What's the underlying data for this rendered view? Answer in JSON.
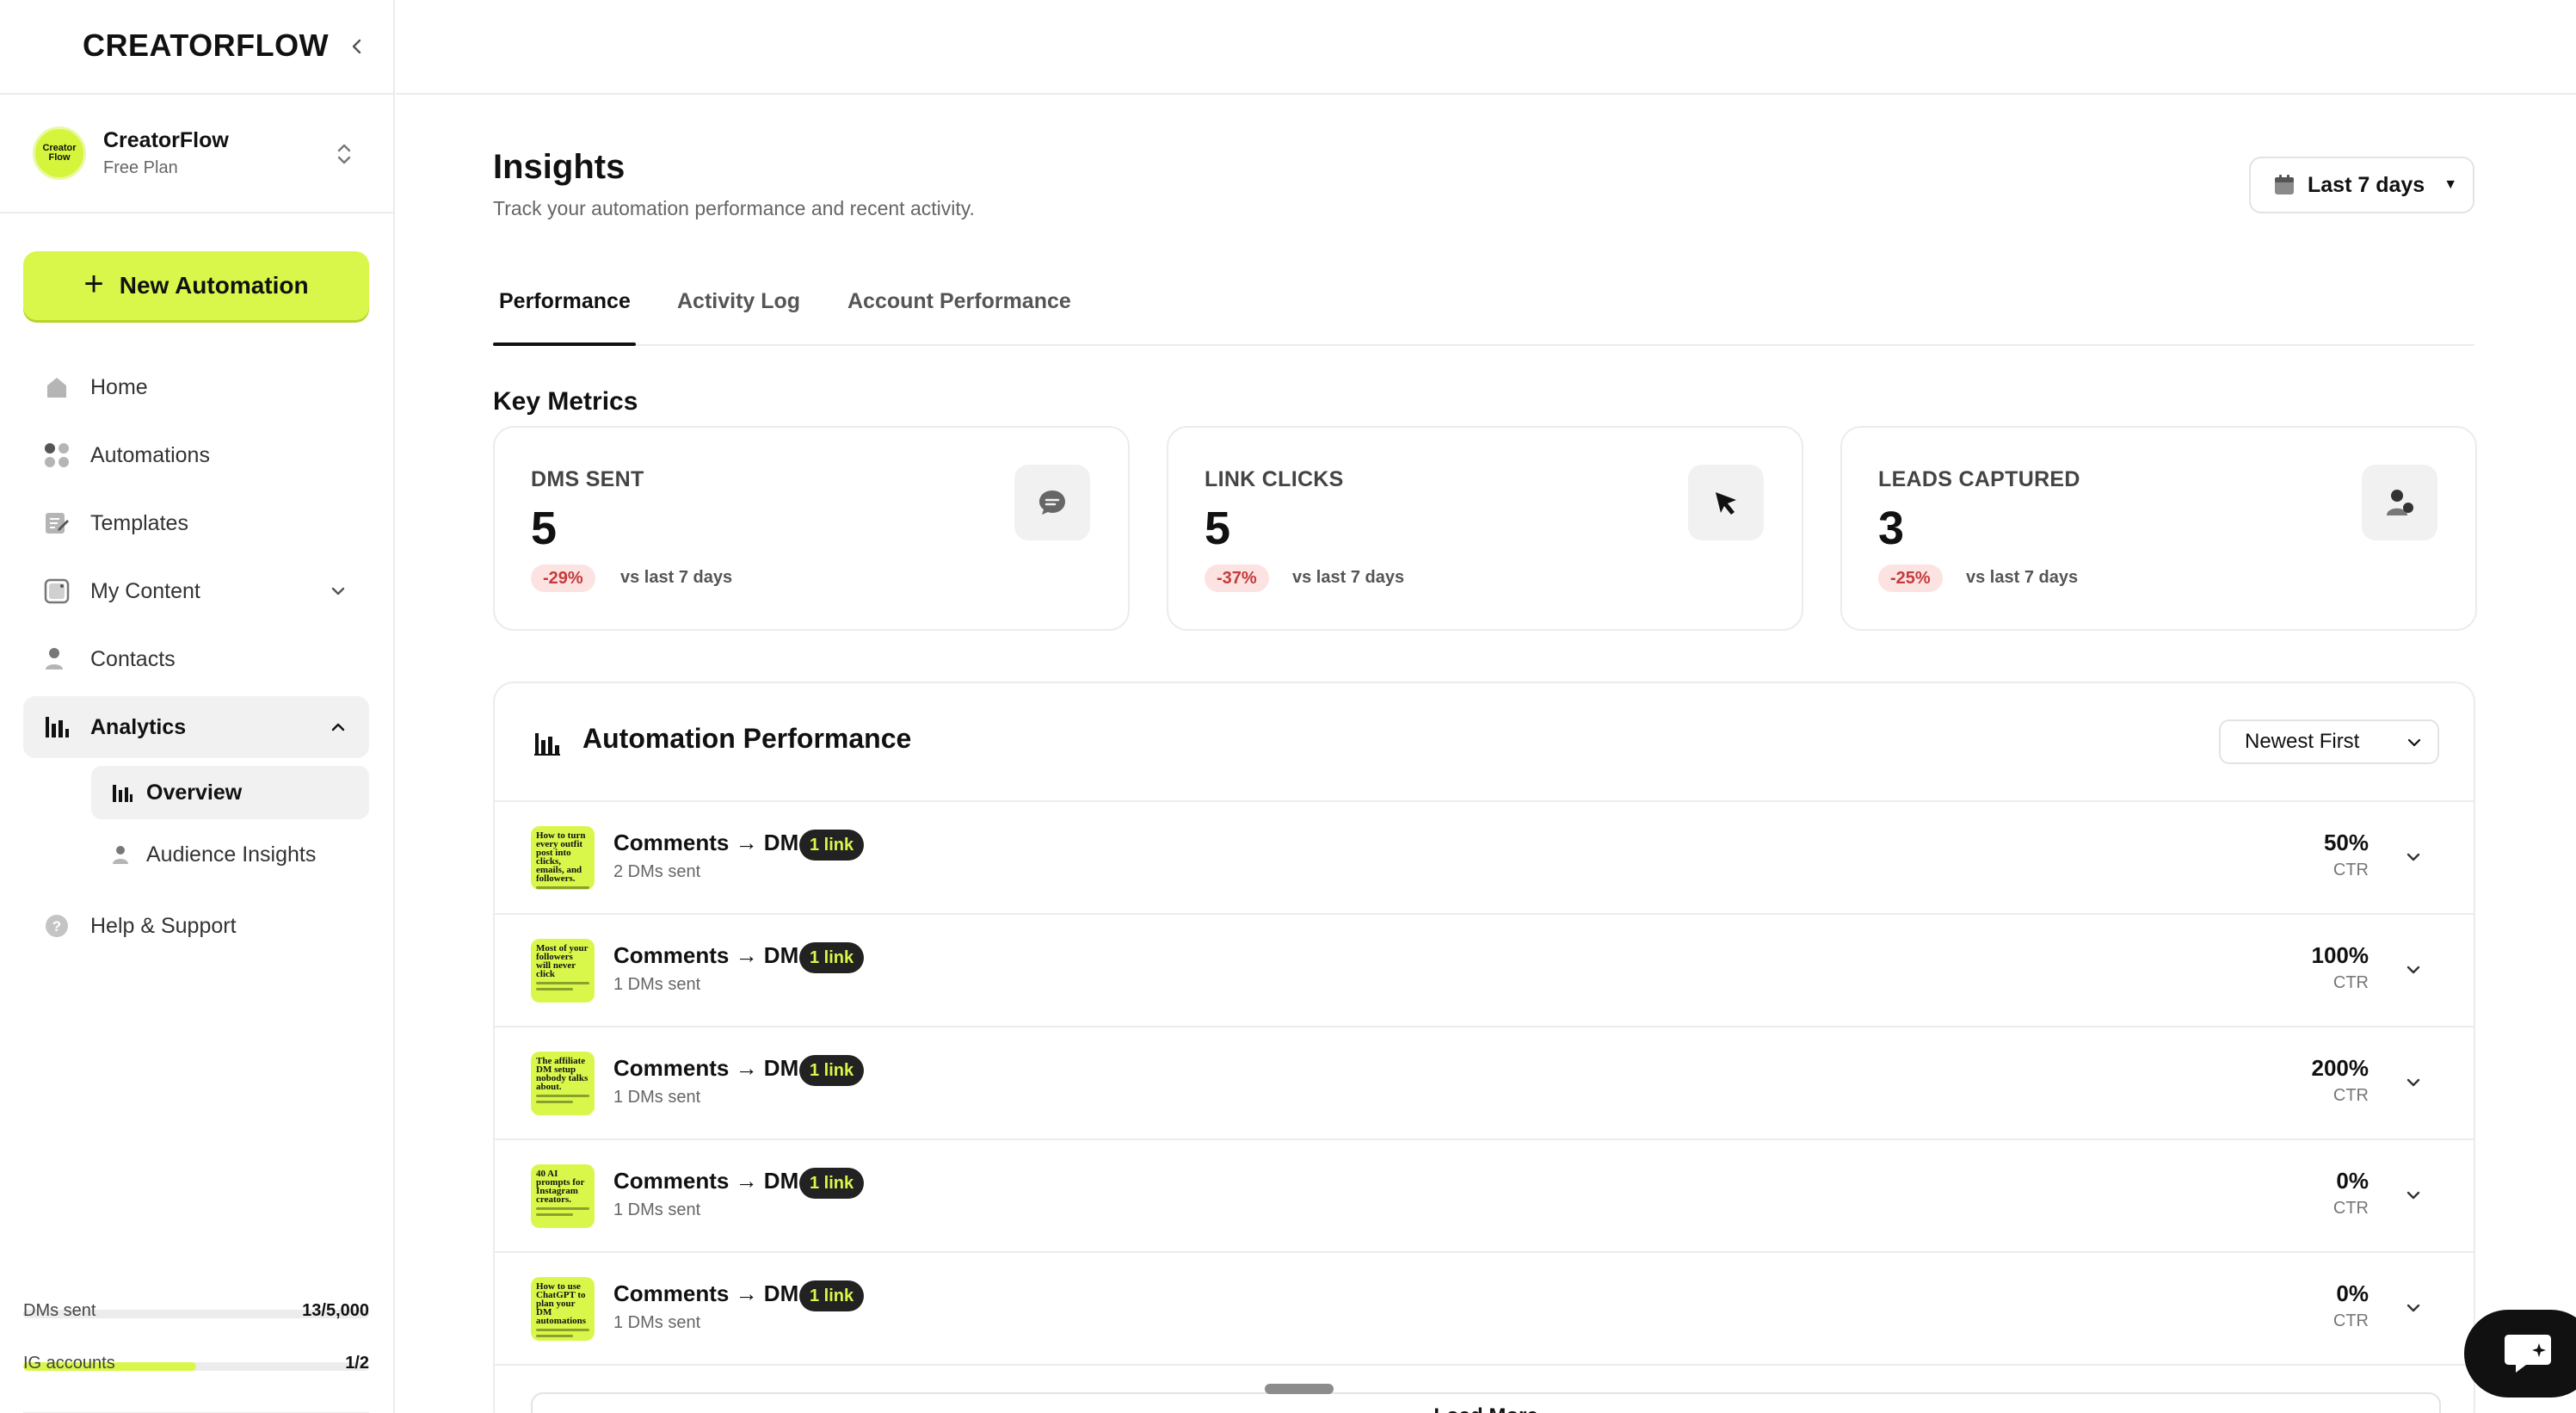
{
  "brand": {
    "name": "CREATORFLOW"
  },
  "account": {
    "name": "CreatorFlow",
    "plan": "Free Plan",
    "avatar_text": "Creator Flow"
  },
  "sidebar": {
    "new_button": "New Automation",
    "items": [
      {
        "label": "Home",
        "icon": "home-icon"
      },
      {
        "label": "Automations",
        "icon": "automations-icon"
      },
      {
        "label": "Templates",
        "icon": "templates-icon"
      },
      {
        "label": "My Content",
        "icon": "content-icon"
      },
      {
        "label": "Contacts",
        "icon": "contacts-icon"
      },
      {
        "label": "Analytics",
        "icon": "analytics-icon"
      },
      {
        "label": "Help & Support",
        "icon": "help-icon"
      }
    ],
    "sub_items": [
      {
        "label": "Overview",
        "icon": "bar-chart-icon"
      },
      {
        "label": "Audience Insights",
        "icon": "audience-icon"
      }
    ],
    "usage": [
      {
        "label": "DMs sent",
        "value": "13/5,000",
        "fraction": 0.0026
      },
      {
        "label": "IG accounts",
        "value": "1/2",
        "fraction": 0.5
      }
    ]
  },
  "header": {
    "title": "Insights",
    "subtitle": "Track your automation performance and recent activity.",
    "range": "Last 7 days"
  },
  "tabs": [
    {
      "label": "Performance",
      "active": true
    },
    {
      "label": "Activity Log",
      "active": false
    },
    {
      "label": "Account Performance",
      "active": false
    }
  ],
  "metrics": {
    "section_title": "Key Metrics",
    "cards": [
      {
        "name": "DMS SENT",
        "value": "5",
        "delta": "-29%",
        "vs": "vs last 7 days",
        "icon": "chat-bubble-icon"
      },
      {
        "name": "LINK CLICKS",
        "value": "5",
        "delta": "-37%",
        "vs": "vs last 7 days",
        "icon": "cursor-icon"
      },
      {
        "name": "LEADS CAPTURED",
        "value": "3",
        "delta": "-25%",
        "vs": "vs last 7 days",
        "icon": "person-icon"
      }
    ]
  },
  "performance": {
    "title": "Automation Performance",
    "sort": "Newest First",
    "ctr_label": "CTR",
    "rows": [
      {
        "title": "Comments → DM",
        "badge": "1 link",
        "sub": "2 DMs sent",
        "ctr": "50%",
        "thumb": "How to turn every outfit post into clicks, emails, and followers."
      },
      {
        "title": "Comments → DM",
        "badge": "1 link",
        "sub": "1 DMs sent",
        "ctr": "100%",
        "thumb": "Most of your followers will never click"
      },
      {
        "title": "Comments → DM",
        "badge": "1 link",
        "sub": "1 DMs sent",
        "ctr": "200%",
        "thumb": "The affiliate DM setup nobody talks about."
      },
      {
        "title": "Comments → DM",
        "badge": "1 link",
        "sub": "1 DMs sent",
        "ctr": "0%",
        "thumb": "40 AI prompts for Instagram creators."
      },
      {
        "title": "Comments → DM",
        "badge": "1 link",
        "sub": "1 DMs sent",
        "ctr": "0%",
        "thumb": "How to use ChatGPT to plan your DM automations"
      }
    ],
    "load_more": "Load More"
  }
}
